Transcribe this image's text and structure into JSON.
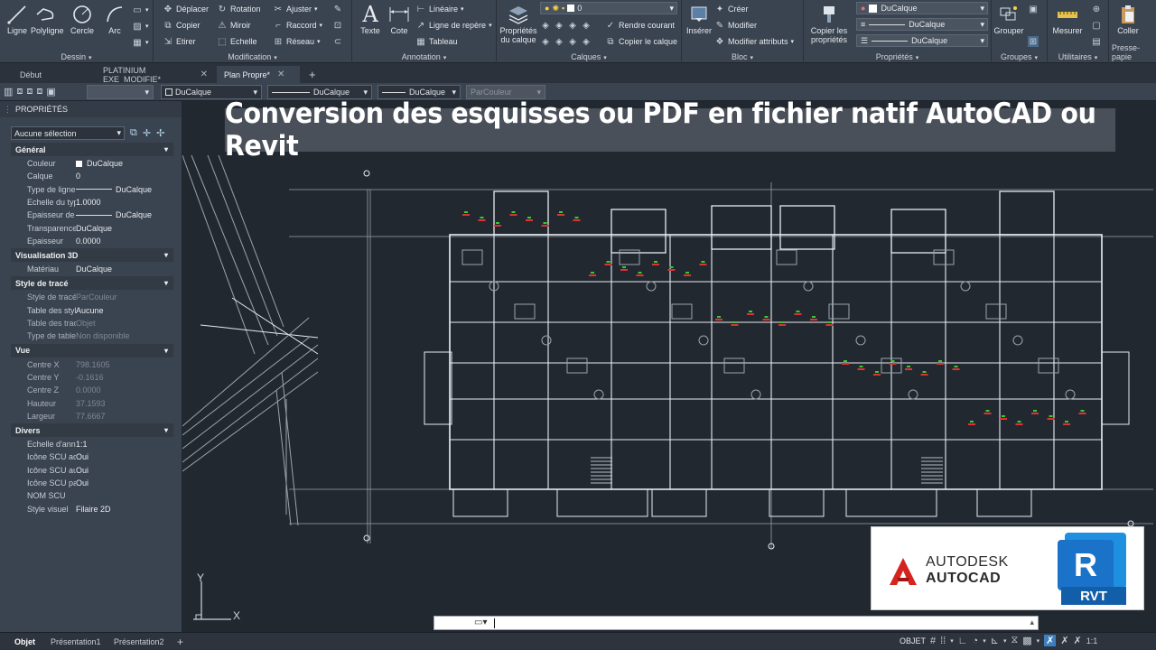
{
  "ribbon": {
    "dessin": {
      "title": "Dessin",
      "tools": [
        "Ligne",
        "Polyligne",
        "Cercle",
        "Arc"
      ]
    },
    "modification": {
      "title": "Modification",
      "col1": [
        "Déplacer",
        "Copier",
        "Etirer"
      ],
      "col2": [
        "Rotation",
        "Miroir",
        "Echelle"
      ],
      "col3": [
        "Ajuster",
        "Raccord",
        "Réseau"
      ]
    },
    "annotation": {
      "title": "Annotation",
      "big": [
        "Texte",
        "Cote"
      ],
      "items": [
        "Linéaire",
        "Ligne de repère",
        "Tableau"
      ]
    },
    "calques": {
      "title": "Calques",
      "big": "Propriétés du calque",
      "layer_value": "0",
      "items": [
        "Rendre courant",
        "Copier le calque"
      ]
    },
    "bloc": {
      "title": "Bloc",
      "big": "Insérer",
      "items": [
        "Créer",
        "Modifier",
        "Modifier attributs"
      ]
    },
    "proprietes": {
      "title": "Propriétés",
      "big": "Copier les propriétés",
      "combos": [
        "DuCalque",
        "DuCalque",
        "DuCalque"
      ]
    },
    "groupes": {
      "title": "Groupes",
      "big": "Grouper"
    },
    "utilitaires": {
      "title": "Utilitaires",
      "big": "Mesurer"
    },
    "pressepapiers": {
      "title": "Presse-papie",
      "big": "Coller"
    }
  },
  "tabs": [
    {
      "label": "Début"
    },
    {
      "label": "PLATINIUM EXE_MODIFIE*"
    },
    {
      "label": "Plan Propre*"
    }
  ],
  "propbar": {
    "color": "DuCalque",
    "linetype": "DuCalque",
    "lineweight": "DuCalque",
    "plotstyle": "ParCouleur"
  },
  "panel": {
    "title": "PROPRIÉTÉS",
    "selection": "Aucune sélection",
    "sections": [
      {
        "name": "Général",
        "rows": [
          {
            "k": "Couleur",
            "v": "DuCalque"
          },
          {
            "k": "Calque",
            "v": "0"
          },
          {
            "k": "Type de ligne",
            "v": "DuCalque"
          },
          {
            "k": "Echelle du typ...",
            "v": "1.0000"
          },
          {
            "k": "Epaisseur de li...",
            "v": "DuCalque"
          },
          {
            "k": "Transparence",
            "v": "DuCalque"
          },
          {
            "k": "Epaisseur",
            "v": "0.0000"
          }
        ]
      },
      {
        "name": "Visualisation 3D",
        "rows": [
          {
            "k": "Matériau",
            "v": "DuCalque"
          }
        ]
      },
      {
        "name": "Style de tracé",
        "rows": [
          {
            "k": "Style de tracé",
            "v": "ParCouleur"
          },
          {
            "k": "Table des style...",
            "v": "Aucune"
          },
          {
            "k": "Table des tracé...",
            "v": "Objet"
          },
          {
            "k": "Type de table...",
            "v": "Non disponible"
          }
        ]
      },
      {
        "name": "Vue",
        "rows": [
          {
            "k": "Centre X",
            "v": "798.1605"
          },
          {
            "k": "Centre Y",
            "v": "-0.1616"
          },
          {
            "k": "Centre Z",
            "v": "0.0000"
          },
          {
            "k": "Hauteur",
            "v": "37.1593"
          },
          {
            "k": "Largeur",
            "v": "77.6667"
          }
        ]
      },
      {
        "name": "Divers",
        "rows": [
          {
            "k": "Echelle d'anno...",
            "v": "1:1"
          },
          {
            "k": "Icône SCU active",
            "v": "Oui"
          },
          {
            "k": "Icône SCU au...",
            "v": "Oui"
          },
          {
            "k": "Icône SCU par...",
            "v": "Oui"
          },
          {
            "k": "NOM SCU",
            "v": ""
          },
          {
            "k": "Style visuel",
            "v": "Filaire 2D"
          }
        ]
      }
    ]
  },
  "banner": "Conversion des esquisses ou PDF en fichier natif AutoCAD ou Revit",
  "logo": {
    "autodesk": "AUTODESK",
    "autocad": "AUTOCAD",
    "rvt": "RVT",
    "r": "R"
  },
  "ucs": {
    "x": "X",
    "y": "Y"
  },
  "status": {
    "tabs": [
      "Objet",
      "Présentation1",
      "Présentation2"
    ],
    "mode": "OBJET",
    "scale": "1:1"
  },
  "colors": {
    "accent": "#1f8fd6",
    "revit_blue": "#1a73c9",
    "autocad_red": "#d6231e",
    "ribbon": "#3a4350",
    "canvas": "#212830"
  }
}
